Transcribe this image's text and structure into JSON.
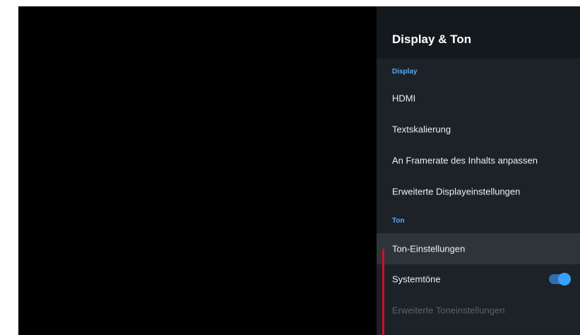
{
  "panel": {
    "title": "Display & Ton"
  },
  "sections": {
    "display_label": "Display",
    "sound_label": "Ton"
  },
  "items": {
    "hdmi": "HDMI",
    "text_scaling": "Textskalierung",
    "framerate": "An Framerate des Inhalts anpassen",
    "advanced_display": "Erweiterte Displayeinstellungen",
    "sound_settings": "Ton-Einstellungen",
    "system_sounds": "Systemtöne",
    "advanced_sound": "Erweiterte Toneinstellungen"
  },
  "state": {
    "focused_item": "Ton-Einstellungen",
    "system_sounds_enabled": true,
    "advanced_sound_enabled": false
  },
  "colors": {
    "background": "#000000",
    "panel_bg": "#1c2227",
    "header_bg": "#14191d",
    "focus_bg": "#2e343a",
    "section_accent": "#5aa8f2",
    "toggle_on": "#3aa0ff",
    "indicator_line": "#d10f2c"
  }
}
